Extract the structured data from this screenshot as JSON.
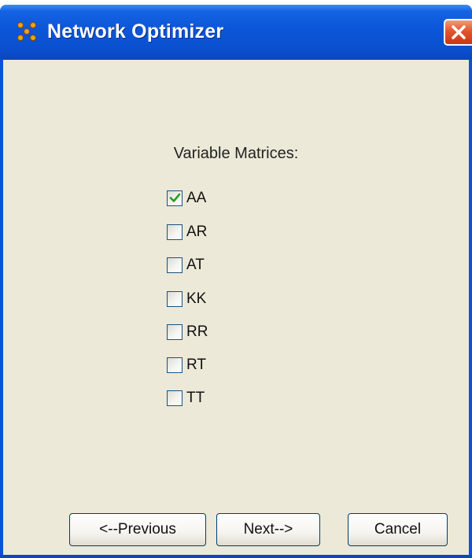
{
  "window": {
    "title": "Network Optimizer",
    "icon": "app-network-icon",
    "close_icon": "close-icon"
  },
  "main": {
    "section_label": "Variable Matrices:",
    "matrices": [
      {
        "label": "AA",
        "checked": true
      },
      {
        "label": "AR",
        "checked": false
      },
      {
        "label": "AT",
        "checked": false
      },
      {
        "label": "KK",
        "checked": false
      },
      {
        "label": "RR",
        "checked": false
      },
      {
        "label": "RT",
        "checked": false
      },
      {
        "label": "TT",
        "checked": false
      }
    ]
  },
  "buttons": {
    "previous": "<--Previous",
    "next": "Next-->",
    "cancel": "Cancel"
  },
  "colors": {
    "titlebar": "#0a53d9",
    "client_bg": "#ece9d8",
    "check_green": "#21a121",
    "close_red": "#e3552a"
  }
}
